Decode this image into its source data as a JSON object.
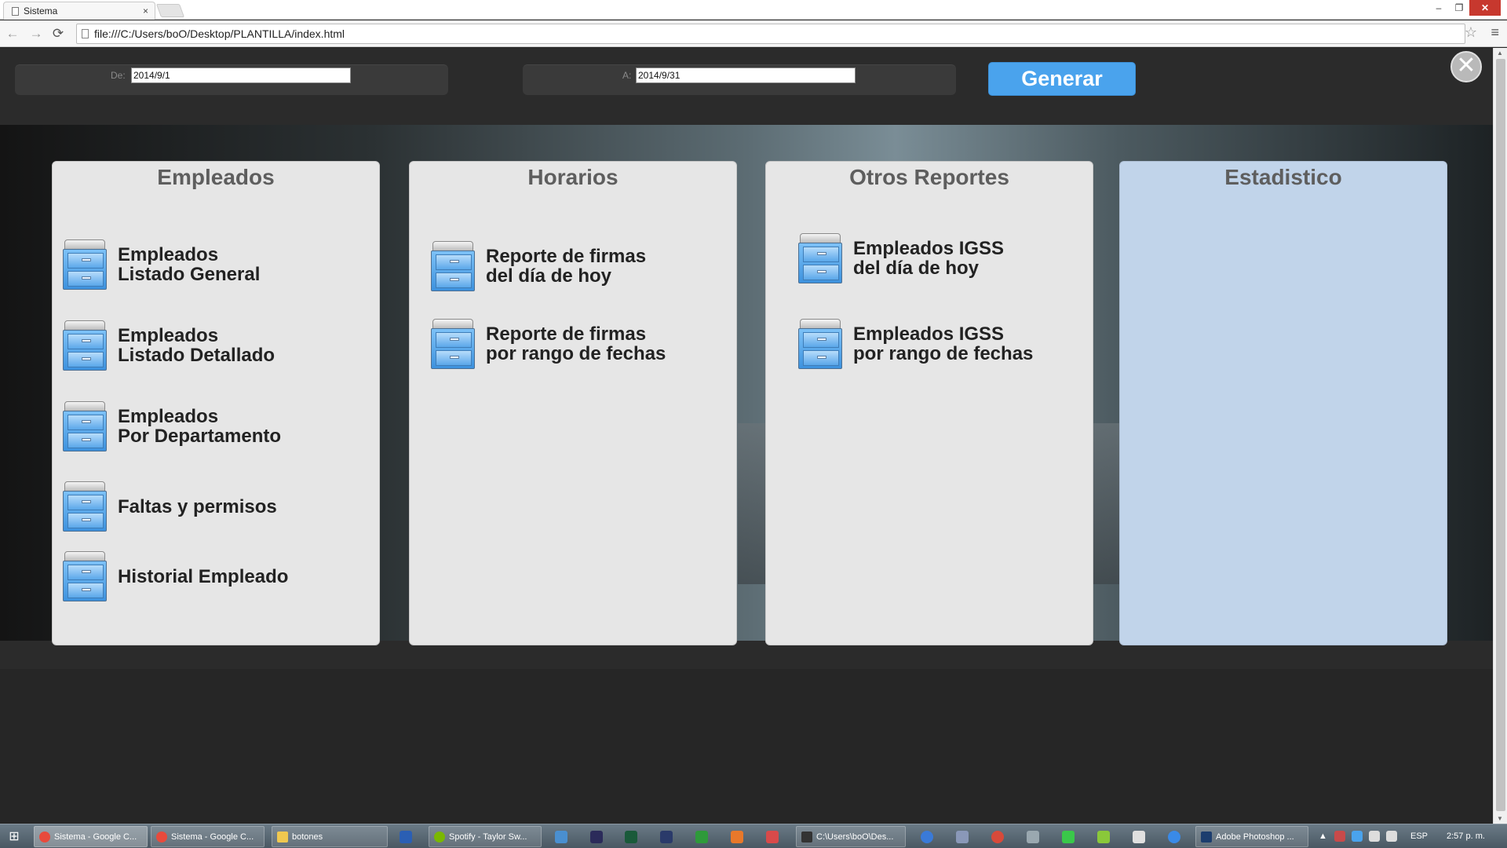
{
  "browser": {
    "tab_title": "Sistema",
    "tab_close": "×",
    "url": "file:///C:/Users/boO/Desktop/PLANTILLA/index.html",
    "back_icon": "←",
    "forward_icon": "→",
    "reload_icon": "⟳",
    "star_icon": "☆",
    "menu_icon": "≡",
    "window_minimize": "–",
    "window_restore": "❐",
    "window_close": "✕"
  },
  "filters": {
    "from_label": "De:",
    "from_value": "2014/9/1",
    "to_label": "A:",
    "to_value": "2014/9/31",
    "generate_label": "Generar",
    "close_symbol": "✕"
  },
  "panels": {
    "empleados": {
      "title": "Empleados",
      "items": [
        {
          "label": "Empleados\nListado General"
        },
        {
          "label": "Empleados\nListado Detallado"
        },
        {
          "label": "Empleados\nPor Departamento"
        },
        {
          "label": "Faltas y permisos"
        },
        {
          "label": "Historial Empleado"
        }
      ]
    },
    "horarios": {
      "title": "Horarios",
      "items": [
        {
          "label": "Reporte de firmas\ndel día de hoy"
        },
        {
          "label": "Reporte de firmas\npor rango de fechas"
        }
      ]
    },
    "otros": {
      "title": "Otros Reportes",
      "items": [
        {
          "label": "Empleados IGSS\ndel día de hoy"
        },
        {
          "label": "Empleados IGSS\npor rango de fechas"
        }
      ]
    },
    "estadistico": {
      "title": "Estadistico"
    }
  },
  "taskbar": {
    "start_icon": "⊞",
    "buttons": [
      "Sistema - Google C...",
      "Sistema - Google C...",
      "botones",
      "Spotify - Taylor Sw...",
      "C:\\Users\\boO\\Des...",
      "Adobe Photoshop ..."
    ],
    "language": "ESP",
    "clock": "2:57 p. m."
  },
  "colors": {
    "accent": "#4aa3ed",
    "panel_bg": "#e6e6e6",
    "stat_panel_bg": "#c1d4ea"
  }
}
